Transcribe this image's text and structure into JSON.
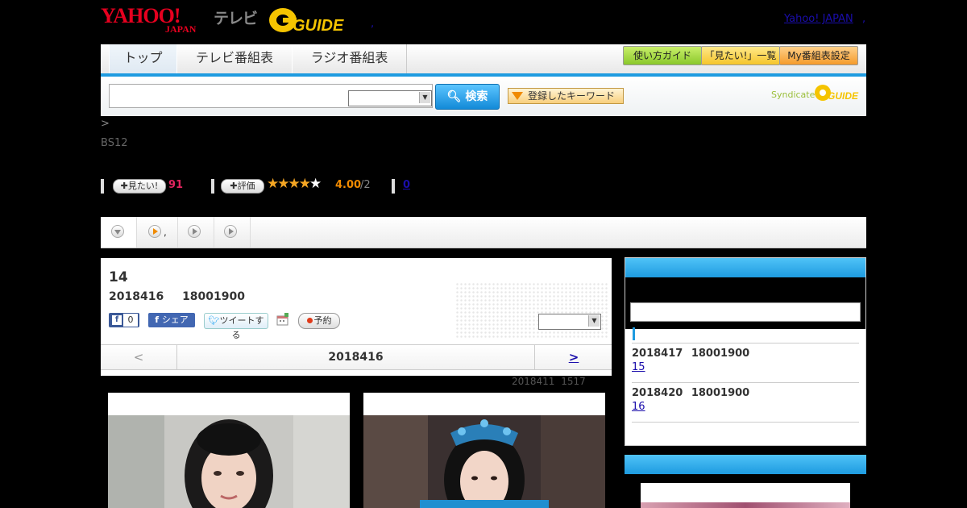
{
  "header": {
    "yahoo_logo_text": "YAHOO! JAPAN",
    "tv_label": "テレビ",
    "gguide_logo_text": "G-GUIDE",
    "yahoo_japan_link": "Yahoo! JAPAN",
    "separator": ","
  },
  "nav": {
    "tabs": [
      {
        "label": "トップ"
      },
      {
        "label": "テレビ番組表"
      },
      {
        "label": "ラジオ番組表"
      }
    ],
    "buttons": [
      {
        "label": "使い方ガイド"
      },
      {
        "label": "「見たい!」一覧"
      },
      {
        "label": "My番組表設定"
      }
    ]
  },
  "search": {
    "input_value": "",
    "select_value": "",
    "button_label": "検索",
    "keyword_button": "登録したキーワード",
    "syndicated_label": "Syndicated",
    "syndicated_logo_text": "G-GUIDE"
  },
  "breadcrumb": ">",
  "channel": "BS12",
  "actions": {
    "want_label": "見たい!",
    "want_count": "91",
    "rate_label": "評価",
    "stars": "★★★★★",
    "rating": 4.0,
    "rating_text": "4.00",
    "rating_denom": "/2",
    "review_count": "0"
  },
  "subtabs": [
    "",
    ",",
    "",
    ""
  ],
  "program": {
    "episode": "14",
    "air_date": "2018416 18001900",
    "fb_like_count": "0",
    "fb_share_label": "シェア",
    "tweet_label": "ツイートする",
    "reserve_label": "予約",
    "select_value": "",
    "pager_prev": "<",
    "pager_date": "2018416",
    "pager_next": ">",
    "updated": "2018411 1517"
  },
  "sidebar": {
    "schedule": [
      {
        "date": "2018417 18001900",
        "episode": "15"
      },
      {
        "date": "2018420 18001900",
        "episode": "16"
      }
    ]
  },
  "colors": {
    "accent_blue": "#1e9be0",
    "want_pink": "#e0245e",
    "rating_orange": "#f08a00",
    "link": "#1a0dab"
  }
}
